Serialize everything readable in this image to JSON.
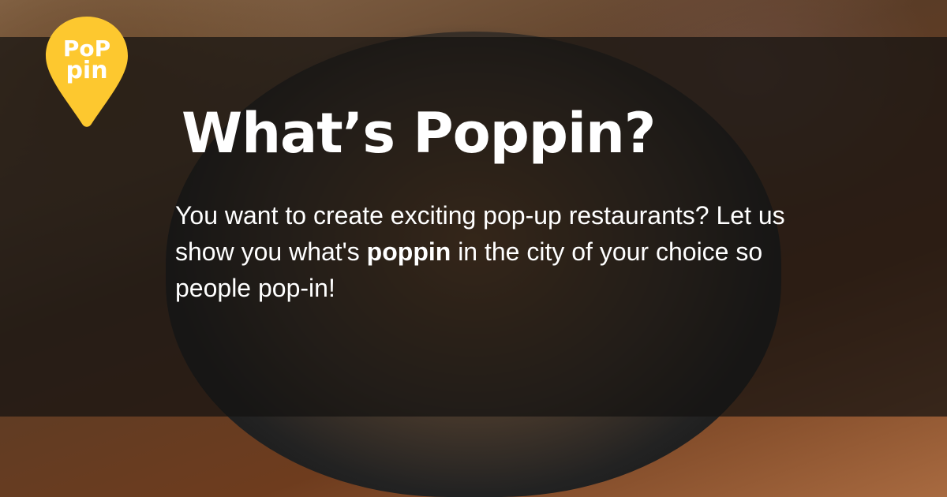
{
  "logo": {
    "text_line1": "PoP",
    "text_line2": "pin",
    "color": "#FDC82F"
  },
  "headline": "What’s Poppin?",
  "body": {
    "before": "You want to create exciting pop-up restaurants? Let us show you what's ",
    "bold": "poppin",
    "after": " in the city of your choice so people pop-in!"
  }
}
